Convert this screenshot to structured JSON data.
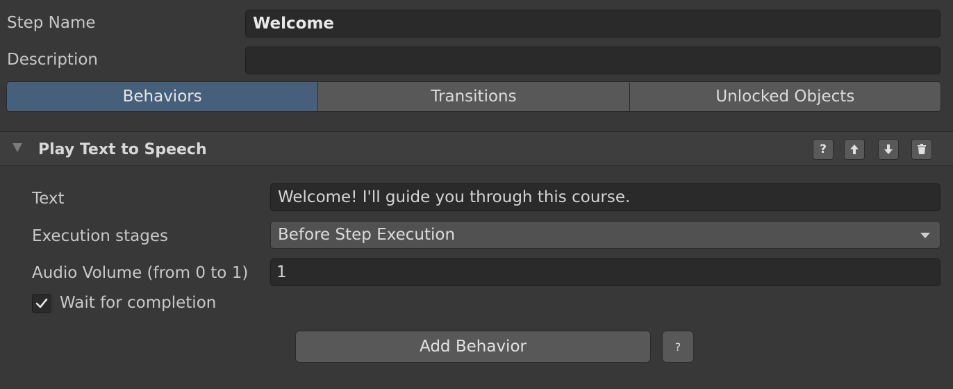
{
  "step": {
    "name_label": "Step Name",
    "name_value": "Welcome",
    "description_label": "Description",
    "description_value": ""
  },
  "tabs": [
    {
      "label": "Behaviors",
      "active": true
    },
    {
      "label": "Transitions",
      "active": false
    },
    {
      "label": "Unlocked Objects",
      "active": false
    }
  ],
  "behavior": {
    "title": "Play Text to Speech",
    "toolbar": {
      "help": "?"
    },
    "text_label": "Text",
    "text_value": "Welcome! I'll guide you through this course.",
    "stages_label": "Execution stages",
    "stages_value": "Before Step Execution",
    "volume_label": "Audio Volume (from 0 to 1)",
    "volume_value": "1",
    "wait_label": "Wait for completion",
    "wait_checked": true
  },
  "add_behavior": {
    "label": "Add Behavior",
    "help": "?"
  }
}
